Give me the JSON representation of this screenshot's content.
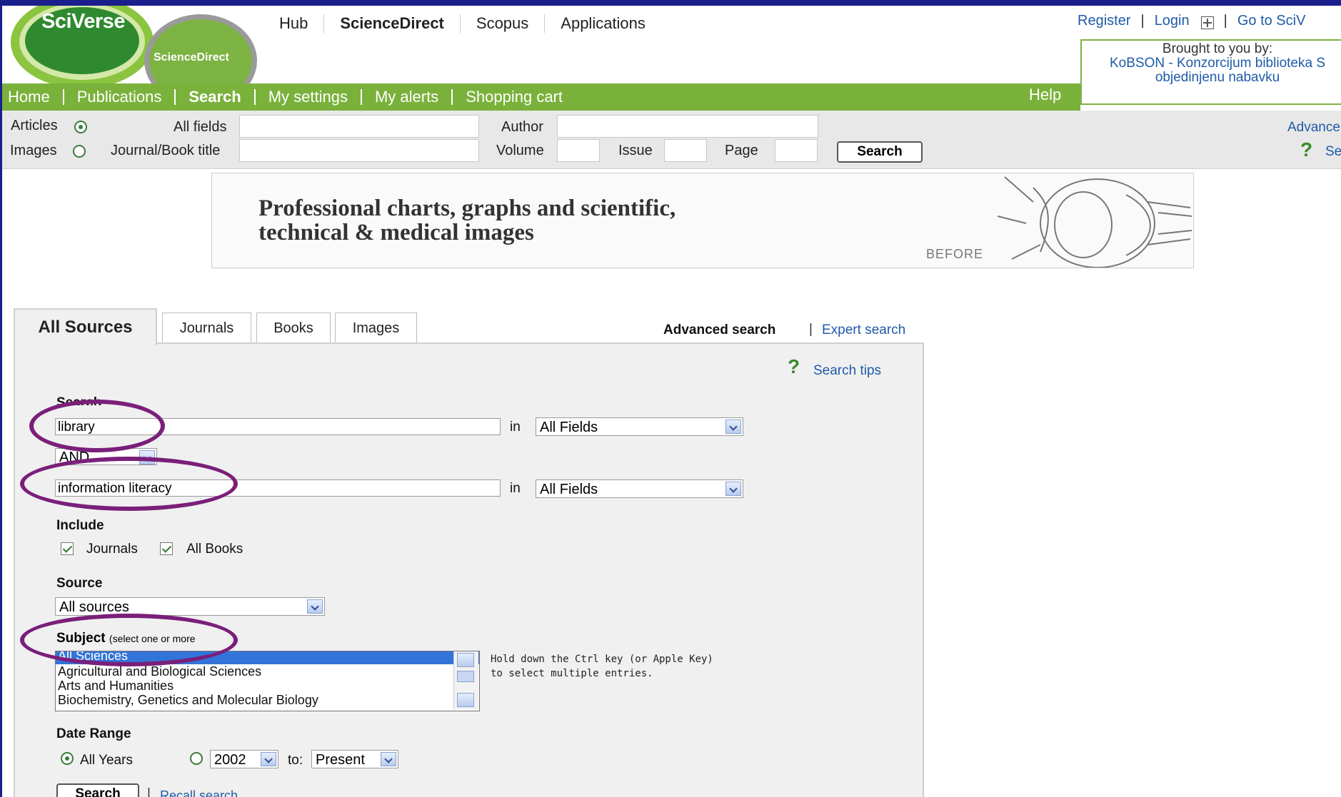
{
  "header": {
    "logo_main": "SciVerse",
    "logo_sub": "ScienceDirect",
    "top_nav": [
      "Hub",
      "ScienceDirect",
      "Scopus",
      "Applications"
    ],
    "register": "Register",
    "login": "Login",
    "go_to": "Go to SciV",
    "brought_by": {
      "line1": "Brought to you by:",
      "line2": "KoBSON - Konzorcijum biblioteka S",
      "line3": "objedinjenu nabavku"
    }
  },
  "green_nav": {
    "items": [
      "Home",
      "Publications",
      "Search",
      "My settings",
      "My alerts",
      "Shopping cart"
    ],
    "active": "Search",
    "help": "Help"
  },
  "quick_search": {
    "articles": "Articles",
    "images": "Images",
    "all_fields": "All fields",
    "journal_title": "Journal/Book title",
    "author": "Author",
    "volume": "Volume",
    "issue": "Issue",
    "page": "Page",
    "search_button": "Search",
    "advanced": "Advance",
    "search_tips_cut": "Se"
  },
  "banner": {
    "line1": "Professional charts, graphs and scientific,",
    "line2": "technical & medical images",
    "before": "BEFORE"
  },
  "tabs": [
    "All Sources",
    "Journals",
    "Books",
    "Images"
  ],
  "search_links": {
    "advanced": "Advanced search",
    "expert": "Expert search"
  },
  "form": {
    "search_tips": "Search tips",
    "search_label": "Search",
    "term1": "library",
    "term2": "information literacy",
    "in": "in",
    "field1": "All Fields",
    "field2": "All Fields",
    "operator": "AND",
    "include_label": "Include",
    "include_journals": "Journals",
    "include_books": "All Books",
    "source_label": "Source",
    "source_value": "All sources",
    "subject_label": "Subject",
    "subject_hint": "(select one or more",
    "subjects": [
      "All Sciences",
      "Agricultural and Biological Sciences",
      "Arts and Humanities",
      "Biochemistry, Genetics and Molecular Biology"
    ],
    "ctrl_hint1": "Hold down the Ctrl key (or Apple Key)",
    "ctrl_hint2": "to select multiple entries.",
    "date_label": "Date Range",
    "all_years": "All Years",
    "from_year": "2002",
    "to": "to:",
    "to_year": "Present",
    "search_button": "Search",
    "recall": "Recall search"
  },
  "colors": {
    "green_nav": "#7ab13b",
    "frame": "#1a1f8c",
    "highlight_oval": "#7a1f7a",
    "link": "#1f5ba8"
  }
}
